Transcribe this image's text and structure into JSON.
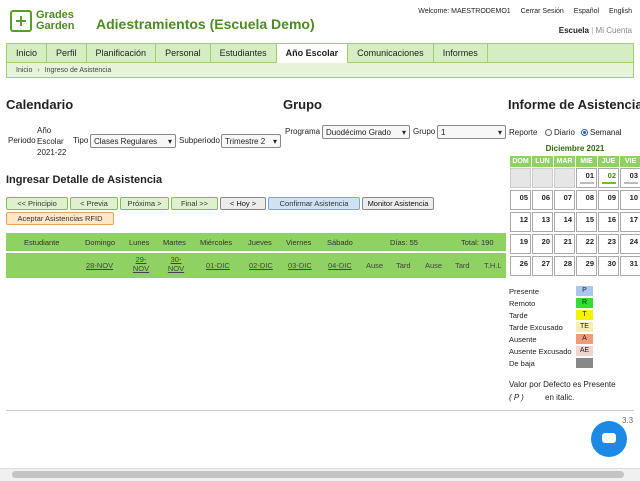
{
  "header": {
    "logo_line1": "Grades",
    "logo_line2": "Garden",
    "school_name": "Adiestramientos (Escuela Demo)",
    "welcome": "Welcome: MAESTRODEMO1",
    "logout": "Cerrar Sesión",
    "lang_es": "Español",
    "lang_en": "English",
    "escuela": "Escuela",
    "mi_cuenta": "Mi Cuenta"
  },
  "nav": {
    "tabs": [
      "Inicio",
      "Perfil",
      "Planificación",
      "Personal",
      "Estudiantes",
      "Año Escolar",
      "Comunicaciones",
      "Informes"
    ],
    "active": "Año Escolar"
  },
  "breadcrumb": {
    "home": "Inicio",
    "current": "Ingreso de Asistencia"
  },
  "calendario": {
    "title": "Calendario",
    "periodo_label": "Periodo",
    "ano_escolar": "Año Escolar 2021-22",
    "tipo_label": "Tipo",
    "tipo_value": "Clases Regulares",
    "subperiodo_label": "Subperiodo",
    "subperiodo_value": "Trimestre 2"
  },
  "grupo": {
    "title": "Grupo",
    "programa_label": "Programa",
    "programa_value": "Duodécimo Grado",
    "grupo_label": "Grupo",
    "grupo_value": "1"
  },
  "detalle": {
    "title": "Ingresar Detalle de Asistencia",
    "btn_principio": "<< Principio",
    "btn_previa": "< Previa",
    "btn_proxima": "Próxima >",
    "btn_final": "Final >>",
    "btn_hoy": "< Hoy >",
    "btn_confirmar": "Confirmar Asistencia",
    "btn_monitor": "Monitor Asistencia",
    "btn_rfid": "Aceptar Asistencias RFID"
  },
  "table": {
    "col_estudiante": "Estudiante",
    "days": [
      "Domingo",
      "Lunes",
      "Martes",
      "Miércoles",
      "Jueves",
      "Viernes",
      "Sábado"
    ],
    "dias": "Días: 55",
    "total": "Total: 190",
    "dates": [
      "28-NOV",
      "29-NOV",
      "30-NOV",
      "01-DIC",
      "02-DIC",
      "03-DIC",
      "04-DIC"
    ],
    "summary": [
      "Ause",
      "Tard",
      "Ause",
      "Tard",
      "T.H.L"
    ]
  },
  "informe": {
    "title": "Informe de Asistencia",
    "reporte_label": "Reporte",
    "diario": "Diario",
    "semanal": "Semanal",
    "selected": "Semanal",
    "month": "Diciembre 2021",
    "dow": [
      "DOM",
      "LUN",
      "MAR",
      "MIE",
      "JUE",
      "VIE"
    ],
    "weeks": [
      [
        "",
        "",
        "",
        "01",
        "02",
        "03"
      ],
      [
        "05",
        "06",
        "07",
        "08",
        "09",
        "10"
      ],
      [
        "12",
        "13",
        "14",
        "15",
        "16",
        "17"
      ],
      [
        "19",
        "20",
        "21",
        "22",
        "23",
        "24"
      ],
      [
        "26",
        "27",
        "28",
        "29",
        "30",
        "31"
      ]
    ]
  },
  "legend": [
    {
      "label": "Presente",
      "code": "P",
      "color": "#a9c7ef"
    },
    {
      "label": "Remoto",
      "code": "R",
      "color": "#33dd33"
    },
    {
      "label": "Tarde",
      "code": "T",
      "color": "#f4f400"
    },
    {
      "label": "Tarde Excusado",
      "code": "TE",
      "color": "#f7edb0"
    },
    {
      "label": "Ausente",
      "code": "A",
      "color": "#f19a7a"
    },
    {
      "label": "Ausente Excusado",
      "code": "AE",
      "color": "#f3d5d0"
    },
    {
      "label": "De baja",
      "code": "",
      "color": "#888888"
    }
  ],
  "default_note": "Valor por Defecto es Presente",
  "default_code": "( P )",
  "default_italic": "en italic.",
  "footer_version": "3.3"
}
